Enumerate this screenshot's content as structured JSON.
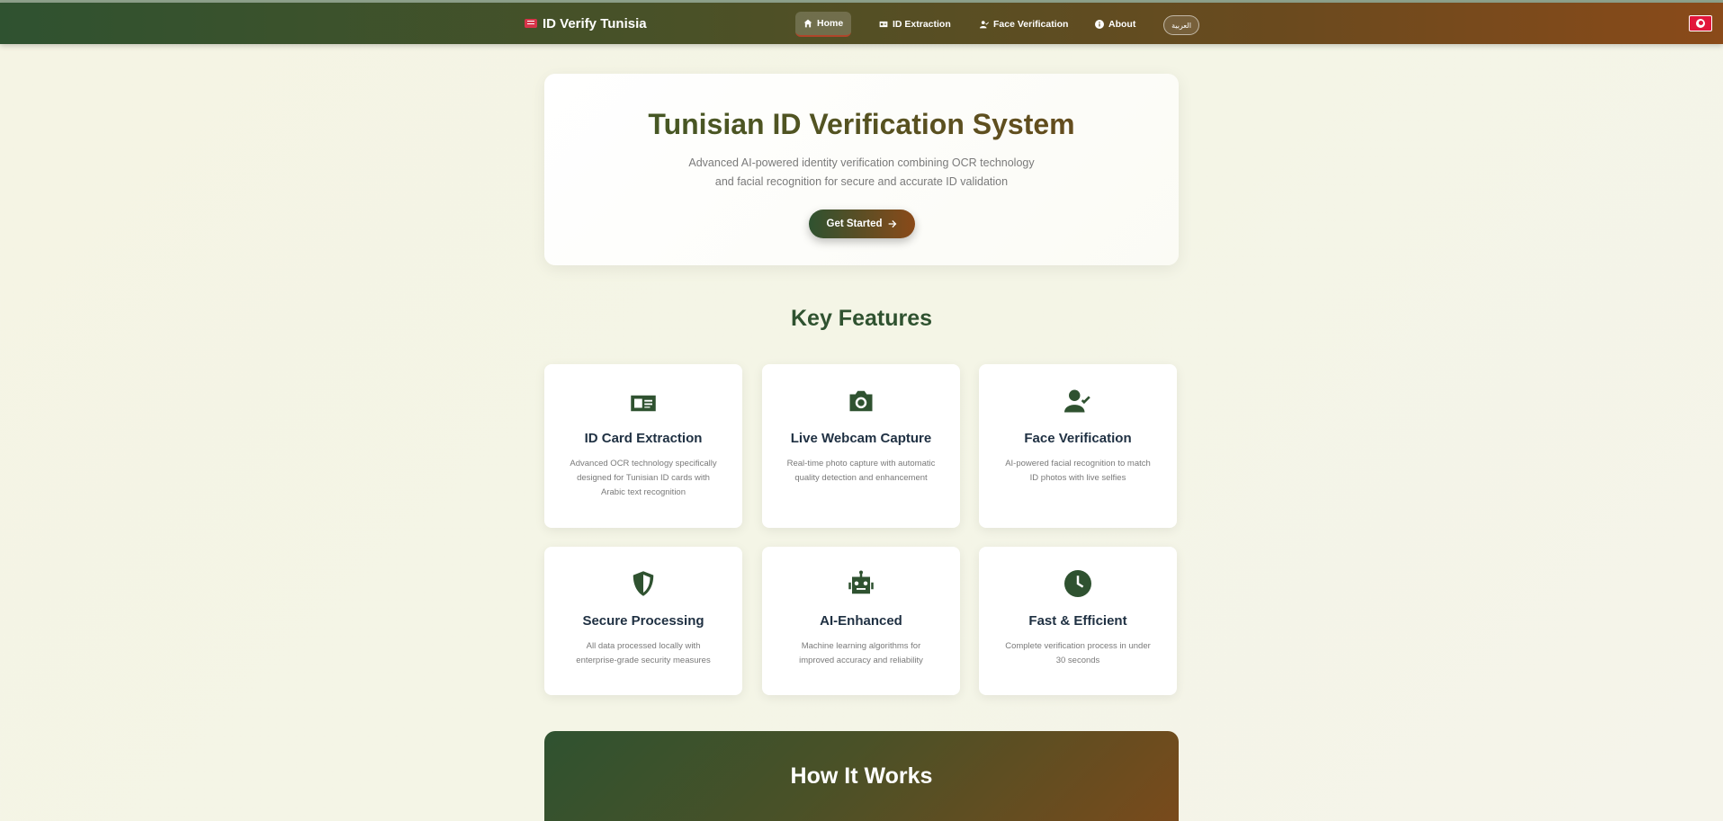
{
  "nav": {
    "brand": "ID Verify Tunisia",
    "items": [
      {
        "label": "Home",
        "icon": "home-icon",
        "active": true
      },
      {
        "label": "ID Extraction",
        "icon": "id-card-icon",
        "active": false
      },
      {
        "label": "Face Verification",
        "icon": "user-check-icon",
        "active": false
      },
      {
        "label": "About",
        "icon": "info-icon",
        "active": false
      }
    ],
    "language_button": "العربية",
    "flag": "tunisia-flag-icon"
  },
  "hero": {
    "title": "Tunisian ID Verification System",
    "subtitle_line1": "Advanced AI-powered identity verification combining OCR technology",
    "subtitle_line2": "and facial recognition for secure and accurate ID validation",
    "cta_label": "Get Started"
  },
  "features": {
    "title": "Key Features",
    "cards": [
      {
        "icon": "id-card-icon",
        "title": "ID Card Extraction",
        "lines": [
          "Advanced OCR technology specifically",
          "designed for Tunisian ID cards with",
          "Arabic text recognition"
        ]
      },
      {
        "icon": "camera-icon",
        "title": "Live Webcam Capture",
        "lines": [
          "Real-time photo capture with automatic",
          "quality detection and enhancement"
        ]
      },
      {
        "icon": "user-check-icon",
        "title": "Face Verification",
        "lines": [
          "AI-powered facial recognition to match",
          "ID photos with live selfies"
        ]
      },
      {
        "icon": "shield-icon",
        "title": "Secure Processing",
        "lines": [
          "All data processed locally with",
          "enterprise-grade security measures"
        ]
      },
      {
        "icon": "robot-icon",
        "title": "AI-Enhanced",
        "lines": [
          "Machine learning algorithms for",
          "improved accuracy and reliability"
        ]
      },
      {
        "icon": "clock-icon",
        "title": "Fast & Efficient",
        "lines": [
          "Complete verification process in under",
          "30 seconds"
        ]
      }
    ]
  },
  "how_it_works": {
    "title": "How It Works"
  },
  "colors": {
    "primary": "#2f5230",
    "accent": "#8a4a19",
    "flag_red": "#e2163a"
  }
}
